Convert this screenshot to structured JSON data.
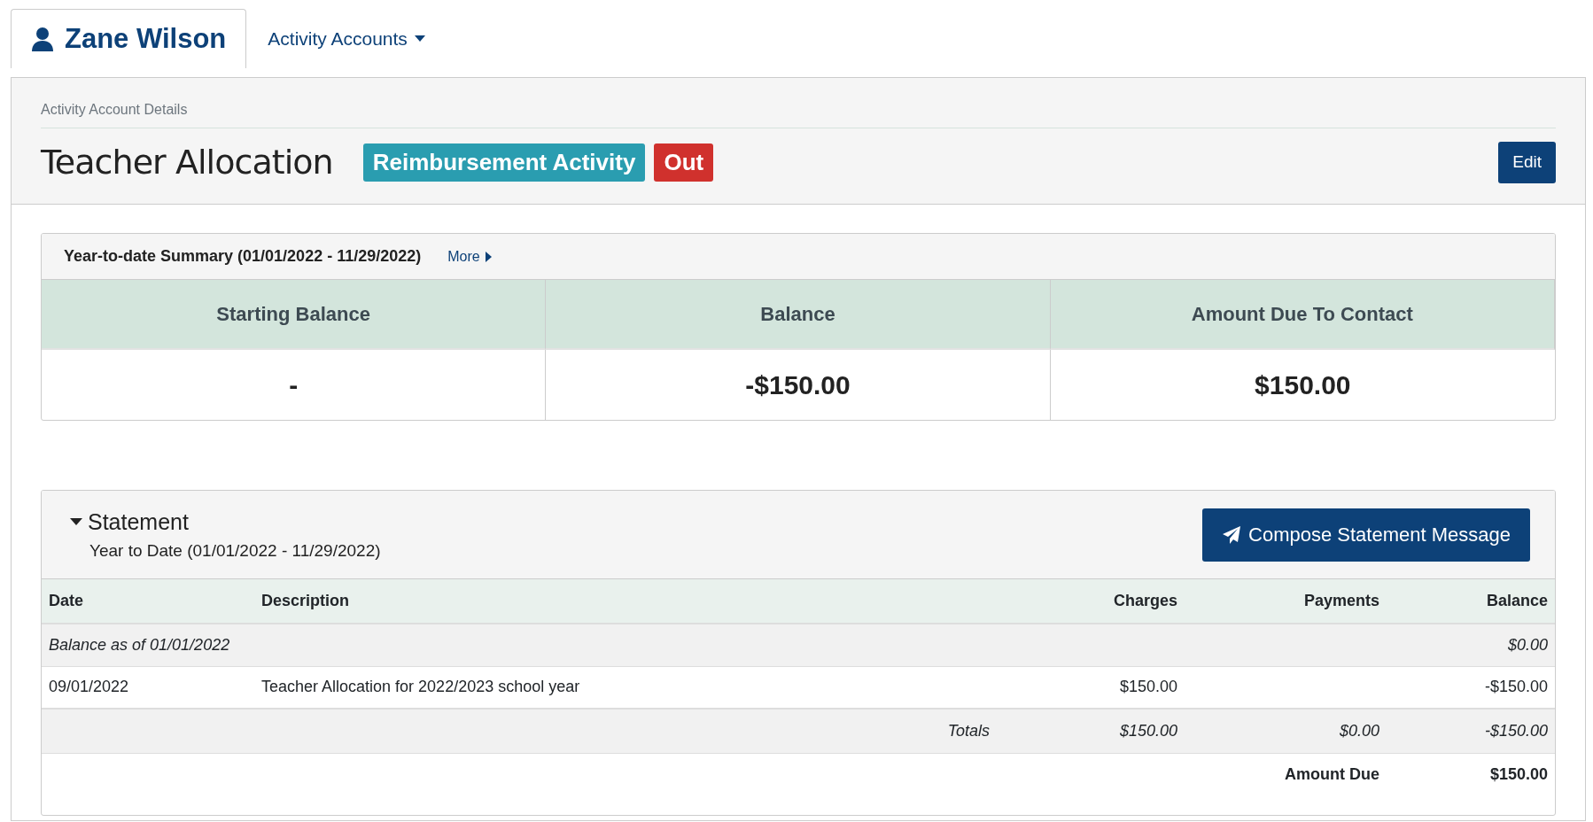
{
  "tabs": [
    {
      "kind": "person",
      "label": "Zane Wilson",
      "selected": true
    },
    {
      "kind": "dropdown",
      "label": "Activity Accounts",
      "selected": false
    }
  ],
  "header": {
    "breadcrumb": "Activity Account Details",
    "title": "Teacher Allocation",
    "badges": [
      {
        "label": "Reimbursement Activity",
        "color": "#2a9db0"
      },
      {
        "label": "Out",
        "color": "#d0312d"
      }
    ],
    "edit_button": "Edit"
  },
  "summary": {
    "title": "Year-to-date Summary (01/01/2022 - 11/29/2022)",
    "more_link": "More",
    "columns": [
      "Starting Balance",
      "Balance",
      "Amount Due To Contact"
    ],
    "values": [
      "-",
      "-$150.00",
      "$150.00"
    ]
  },
  "statement": {
    "title": "Statement",
    "expanded": true,
    "subtitle": "Year to Date (01/01/2022 - 11/29/2022)",
    "compose_button": "Compose Statement Message",
    "columns": [
      "Date",
      "Description",
      "Charges",
      "Payments",
      "Balance"
    ],
    "rows": [
      {
        "kind": "opening",
        "label": "Balance as of 01/01/2022",
        "balance": "$0.00"
      },
      {
        "kind": "entry",
        "date": "09/01/2022",
        "description": "Teacher Allocation for 2022/2023 school year",
        "charges": "$150.00",
        "balance": "-$150.00"
      },
      {
        "kind": "totals",
        "label": "Totals",
        "charges": "$150.00",
        "payments": "$0.00",
        "balance": "-$150.00"
      },
      {
        "kind": "due",
        "label": "Amount Due",
        "balance": "$150.00"
      }
    ]
  }
}
